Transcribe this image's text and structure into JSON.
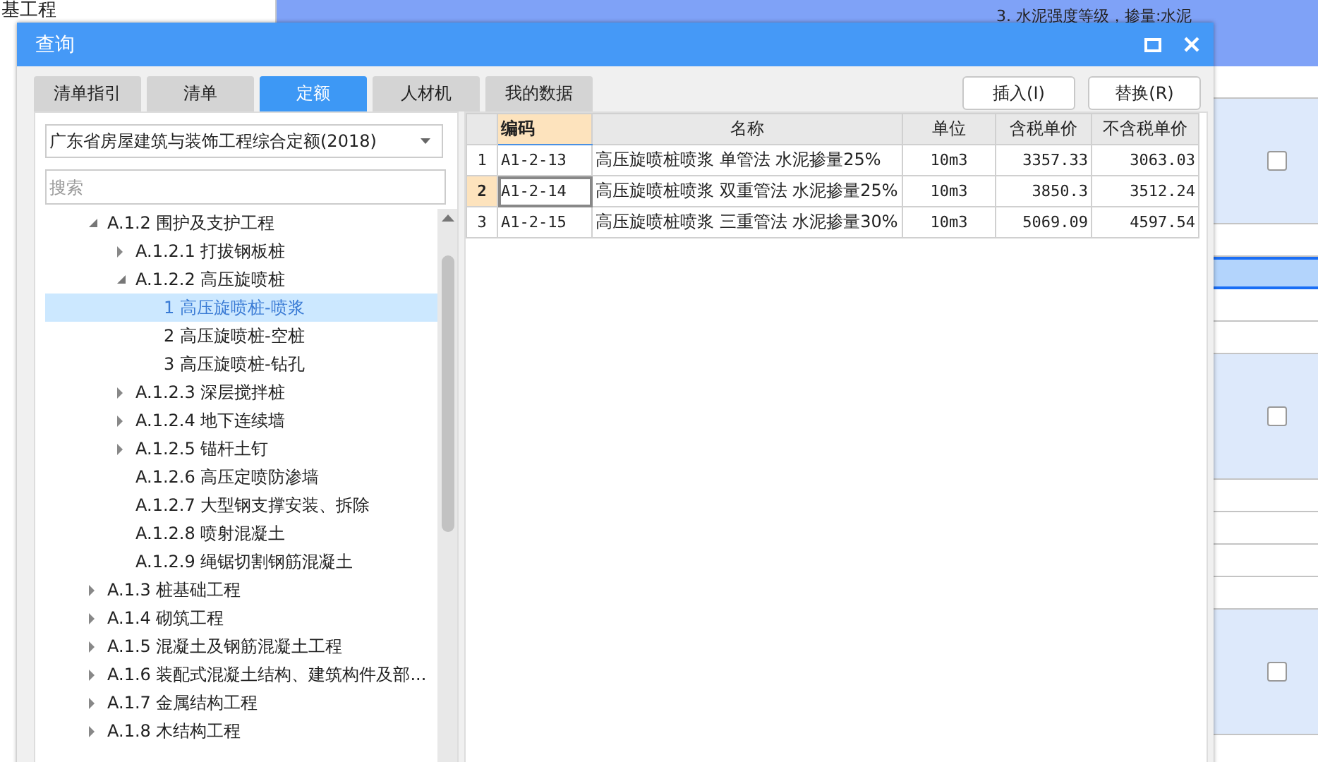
{
  "background": {
    "left_items": [
      "基工程"
    ],
    "top_text": "3. 水泥强度等级，掺量:水泥",
    "right_rows": [
      {
        "kind": "plain"
      },
      {
        "kind": "check",
        "checked": false
      },
      {
        "kind": "plain"
      },
      {
        "kind": "current"
      },
      {
        "kind": "plain"
      },
      {
        "kind": "plain"
      },
      {
        "kind": "check",
        "checked": false
      },
      {
        "kind": "plain"
      },
      {
        "kind": "plain"
      },
      {
        "kind": "plain"
      },
      {
        "kind": "plain"
      },
      {
        "kind": "check",
        "checked": false
      }
    ]
  },
  "window": {
    "title": "查询"
  },
  "tabs": [
    {
      "label": "清单指引",
      "selected": false
    },
    {
      "label": "清单",
      "selected": false
    },
    {
      "label": "定额",
      "selected": true
    },
    {
      "label": "人材机",
      "selected": false
    },
    {
      "label": "我的数据",
      "selected": false
    }
  ],
  "buttons": [
    "插入(I)",
    "替换(R)"
  ],
  "library": {
    "value": "广东省房屋建筑与装饰工程综合定额(2018)"
  },
  "search": {
    "placeholder": "搜索"
  },
  "tree": [
    {
      "label": "A.1.2 围护及支护工程",
      "expanded": true,
      "selected": false,
      "children": [
        {
          "label": "A.1.2.1 打拔钢板桩",
          "expanded": false,
          "selected": false
        },
        {
          "label": "A.1.2.2 高压旋喷桩",
          "expanded": true,
          "selected": false,
          "children": [
            {
              "label": "1 高压旋喷桩-喷浆",
              "selected": true
            },
            {
              "label": "2 高压旋喷桩-空桩",
              "selected": false
            },
            {
              "label": "3 高压旋喷桩-钻孔",
              "selected": false
            }
          ]
        },
        {
          "label": "A.1.2.3 深层搅拌桩",
          "expanded": false,
          "selected": false
        },
        {
          "label": "A.1.2.4 地下连续墙",
          "expanded": false,
          "selected": false
        },
        {
          "label": "A.1.2.5 锚杆土钉",
          "expanded": false,
          "selected": false
        },
        {
          "label": "A.1.2.6 高压定喷防渗墙",
          "selected": false
        },
        {
          "label": "A.1.2.7 大型钢支撑安装、拆除",
          "selected": false
        },
        {
          "label": "A.1.2.8 喷射混凝土",
          "selected": false
        },
        {
          "label": "A.1.2.9 绳锯切割钢筋混凝土",
          "selected": false
        }
      ]
    },
    {
      "label": "A.1.3 桩基础工程",
      "expanded": false,
      "selected": false
    },
    {
      "label": "A.1.4 砌筑工程",
      "expanded": false,
      "selected": false
    },
    {
      "label": "A.1.5 混凝土及钢筋混凝土工程",
      "expanded": false,
      "selected": false
    },
    {
      "label": "A.1.6 装配式混凝土结构、建筑构件及部...",
      "expanded": false,
      "selected": false
    },
    {
      "label": "A.1.7 金属结构工程",
      "expanded": false,
      "selected": false
    },
    {
      "label": "A.1.8 木结构工程",
      "expanded": false,
      "selected": false
    }
  ],
  "table": {
    "columns": [
      "编码",
      "名称",
      "单位",
      "含税单价",
      "不含税单价"
    ],
    "rows": [
      {
        "num": "1",
        "selected": false,
        "cells": [
          "A1-2-13",
          "高压旋喷桩喷浆 单管法 水泥掺量25%",
          "10m3",
          "3357.33",
          "3063.03"
        ]
      },
      {
        "num": "2",
        "selected": true,
        "cells": [
          "A1-2-14",
          "高压旋喷桩喷浆 双重管法 水泥掺量25%",
          "10m3",
          "3850.3",
          "3512.24"
        ]
      },
      {
        "num": "3",
        "selected": false,
        "cells": [
          "A1-2-15",
          "高压旋喷桩喷浆 三重管法 水泥掺量30%",
          "10m3",
          "5069.09",
          "4597.54"
        ]
      }
    ]
  }
}
